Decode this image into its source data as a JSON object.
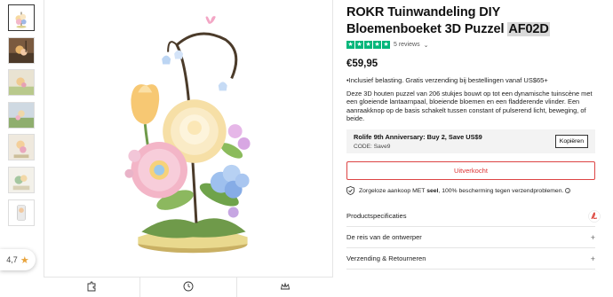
{
  "product": {
    "title_main": "ROKR Tuinwandeling DIY Bloemenboeket 3D Puzzel",
    "title_code": "AF02D",
    "reviews_label": "5 reviews",
    "reviews_chevron": "⌄",
    "price": "€59,95",
    "tax_note": "•Inclusief belasting. Gratis verzending bij bestellingen vanaf US$65+",
    "description": "Deze 3D houten puzzel van 206 stukjes bouwt op tot een dynamische tuinscène met een gloeiende lantaarnpaal, bloeiende bloemen en een fladderende vlinder. Een aanraakknop op de basis schakelt tussen constant of pulserend licht, beweging, of beide."
  },
  "promo": {
    "title": "Rolife 9th Anniversary: Buy 2, Save US$9",
    "code": "CODE: Save9",
    "copy_label": "Kopiëren"
  },
  "buy": {
    "soldout_label": "Uitverkocht"
  },
  "guarantee": {
    "text_before": "Zorgeloze aankoop MET ",
    "text_bold": "seel",
    "text_after": ", 100% bescherming tegen verzendproblemen.",
    "info_glyph": "i"
  },
  "accordion": [
    {
      "label": "Productspecificaties",
      "icon": "pdf-icon"
    },
    {
      "label": "De reis van de ontwerper",
      "icon": "plus-icon"
    },
    {
      "label": "Verzending & Retourneren",
      "icon": "plus-icon"
    }
  ],
  "accordion_plus": "+",
  "rating": {
    "value": "4,7",
    "star": "★"
  },
  "trustpilot_star": "★",
  "colors": {
    "trustpilot": "#00b67a",
    "soldout": "#d33333",
    "rating_star": "#e8a33b",
    "pdf_red": "#d9342b"
  },
  "feature_icons": [
    "puzzle-icon",
    "clock-icon",
    "crown-icon"
  ]
}
